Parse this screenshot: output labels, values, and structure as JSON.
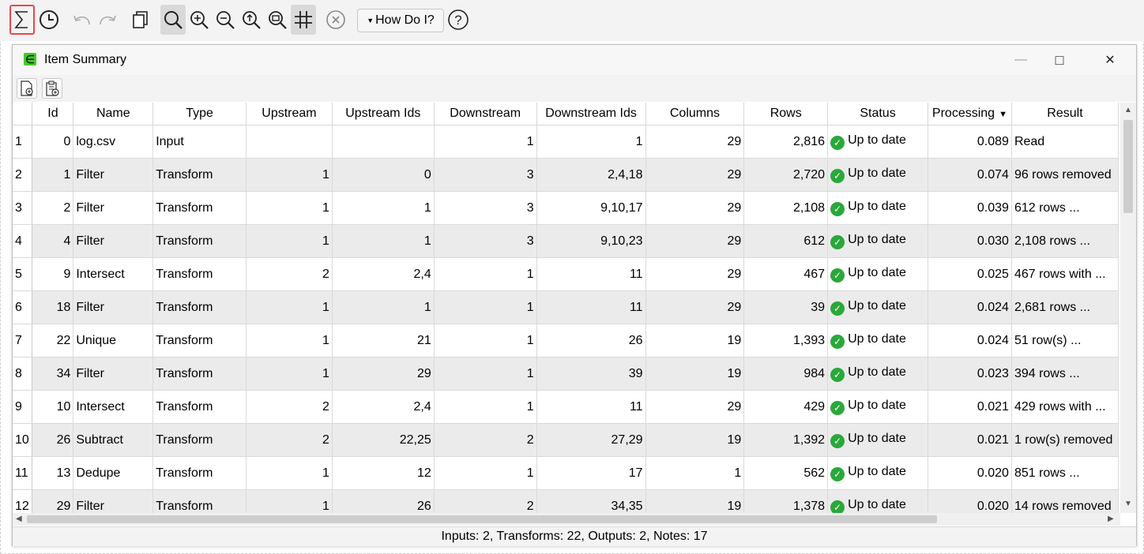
{
  "toolbar": {
    "icons": [
      "sigma-icon",
      "clock-icon",
      "undo-icon",
      "redo-icon",
      "copy-icon",
      "search-icon",
      "zoom-in-icon",
      "zoom-out-icon",
      "zoom-fit-icon",
      "zoom-selection-icon",
      "grid-icon",
      "cancel-icon",
      "help-icon"
    ],
    "how_do_i_label": "How Do I?"
  },
  "window": {
    "title": "Item Summary",
    "minimize_glyph": "—",
    "maximize_glyph": "□",
    "close_glyph": "✕"
  },
  "table": {
    "columns": [
      "Id",
      "Name",
      "Type",
      "Upstream",
      "Upstream Ids",
      "Downstream",
      "Downstream Ids",
      "Columns",
      "Rows",
      "Status",
      "Processing",
      "Result"
    ],
    "sorted_column": "Processing",
    "rows": [
      {
        "rn": "1",
        "id": "0",
        "name": "log.csv",
        "type": "Input",
        "up": "",
        "upids": "",
        "down": "1",
        "downids": "1",
        "cols": "29",
        "rows": "2,816",
        "status": "Up to date",
        "proc": "0.089",
        "result": "Read"
      },
      {
        "rn": "2",
        "id": "1",
        "name": "Filter",
        "type": "Transform",
        "up": "1",
        "upids": "0",
        "down": "3",
        "downids": "2,4,18",
        "cols": "29",
        "rows": "2,720",
        "status": "Up to date",
        "proc": "0.074",
        "result": "96 rows removed"
      },
      {
        "rn": "3",
        "id": "2",
        "name": "Filter",
        "type": "Transform",
        "up": "1",
        "upids": "1",
        "down": "3",
        "downids": "9,10,17",
        "cols": "29",
        "rows": "2,108",
        "status": "Up to date",
        "proc": "0.039",
        "result": "612 rows ..."
      },
      {
        "rn": "4",
        "id": "4",
        "name": "Filter",
        "type": "Transform",
        "up": "1",
        "upids": "1",
        "down": "3",
        "downids": "9,10,23",
        "cols": "29",
        "rows": "612",
        "status": "Up to date",
        "proc": "0.030",
        "result": "2,108 rows ..."
      },
      {
        "rn": "5",
        "id": "9",
        "name": "Intersect",
        "type": "Transform",
        "up": "2",
        "upids": "2,4",
        "down": "1",
        "downids": "11",
        "cols": "29",
        "rows": "467",
        "status": "Up to date",
        "proc": "0.025",
        "result": "467 rows with ..."
      },
      {
        "rn": "6",
        "id": "18",
        "name": "Filter",
        "type": "Transform",
        "up": "1",
        "upids": "1",
        "down": "1",
        "downids": "11",
        "cols": "29",
        "rows": "39",
        "status": "Up to date",
        "proc": "0.024",
        "result": "2,681 rows ..."
      },
      {
        "rn": "7",
        "id": "22",
        "name": "Unique",
        "type": "Transform",
        "up": "1",
        "upids": "21",
        "down": "1",
        "downids": "26",
        "cols": "19",
        "rows": "1,393",
        "status": "Up to date",
        "proc": "0.024",
        "result": "51 row(s) ..."
      },
      {
        "rn": "8",
        "id": "34",
        "name": "Filter",
        "type": "Transform",
        "up": "1",
        "upids": "29",
        "down": "1",
        "downids": "39",
        "cols": "19",
        "rows": "984",
        "status": "Up to date",
        "proc": "0.023",
        "result": "394 rows ..."
      },
      {
        "rn": "9",
        "id": "10",
        "name": "Intersect",
        "type": "Transform",
        "up": "2",
        "upids": "2,4",
        "down": "1",
        "downids": "11",
        "cols": "29",
        "rows": "429",
        "status": "Up to date",
        "proc": "0.021",
        "result": "429 rows with ..."
      },
      {
        "rn": "10",
        "id": "26",
        "name": "Subtract",
        "type": "Transform",
        "up": "2",
        "upids": "22,25",
        "down": "2",
        "downids": "27,29",
        "cols": "19",
        "rows": "1,392",
        "status": "Up to date",
        "proc": "0.021",
        "result": "1 row(s) removed"
      },
      {
        "rn": "11",
        "id": "13",
        "name": "Dedupe",
        "type": "Transform",
        "up": "1",
        "upids": "12",
        "down": "1",
        "downids": "17",
        "cols": "1",
        "rows": "562",
        "status": "Up to date",
        "proc": "0.020",
        "result": "851 rows ..."
      },
      {
        "rn": "12",
        "id": "29",
        "name": "Filter",
        "type": "Transform",
        "up": "1",
        "upids": "26",
        "down": "2",
        "downids": "34,35",
        "cols": "19",
        "rows": "1,378",
        "status": "Up to date",
        "proc": "0.020",
        "result": "14 rows removed"
      }
    ]
  },
  "status_bar": {
    "text": "Inputs: 2, Transforms: 22, Outputs: 2, Notes: 17"
  }
}
